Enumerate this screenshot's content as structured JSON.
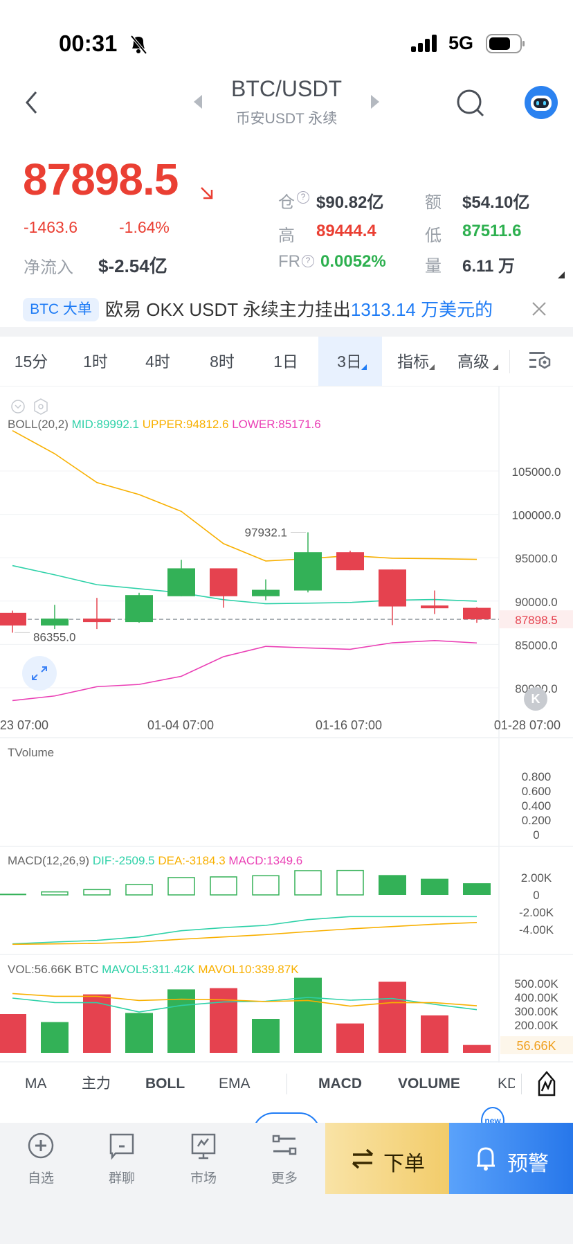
{
  "status_bar": {
    "time": "00:31",
    "network": "5G"
  },
  "header": {
    "title": "BTC/USDT",
    "subtitle": "币安USDT 永续"
  },
  "price": {
    "last": "87898.5",
    "change": "-1463.6",
    "change_pct": "-1.64%",
    "net_inflow_label": "净流入",
    "net_inflow": "$-2.54亿"
  },
  "stats": [
    {
      "label": "仓",
      "value": "$90.82亿"
    },
    {
      "label": "额",
      "value": "$54.10亿"
    },
    {
      "label": "高",
      "value": "89444.4"
    },
    {
      "label": "低",
      "value": "87511.6"
    },
    {
      "label": "FR",
      "value": "0.0052%"
    },
    {
      "label": "量",
      "value": "6.11 万"
    }
  ],
  "ticker": {
    "tag": "BTC 大单",
    "text": "欧易 OKX USDT 永续主力挂出",
    "highlight": "1313.14 万美元的"
  },
  "tabs": [
    "15分",
    "1时",
    "4时",
    "8时",
    "1日",
    "3日",
    "指标",
    "高级"
  ],
  "active_tab": "3日",
  "boll_legend": {
    "name": "BOLL(20,2)",
    "mid": "MID:89992.1",
    "upper": "UPPER:94812.6",
    "lower": "LOWER:85171.6"
  },
  "tvolume_legend": "TVolume",
  "macd_legend": {
    "name": "MACD(12,26,9)",
    "dif": "DIF:-2509.5",
    "dea": "DEA:-3184.3",
    "macd": "MACD:1349.6"
  },
  "vol_legend": {
    "name": "VOL:56.66K BTC",
    "ma5": "MAVOL5:311.42K",
    "ma10": "MAVOL10:339.87K"
  },
  "indicators": [
    "MA",
    "主力",
    "BOLL",
    "EMA",
    "MACD",
    "VOLUME",
    "KD"
  ],
  "new_badge": "new",
  "bottom_nav": [
    "自选",
    "群聊",
    "市场",
    "更多"
  ],
  "order_button": "下单",
  "alert_button": "预警",
  "colors": {
    "up": "#33b157",
    "down": "#e5424f",
    "mid": "#2ed1a8",
    "upper": "#f8b000",
    "lower": "#ea3fb5",
    "accent": "#1f7cf5"
  },
  "chart_data": {
    "type": "candlestick",
    "price_axis": [
      "105000.0",
      "100000.0",
      "95000.0",
      "90000.0",
      "85000.0",
      "80000.0"
    ],
    "x_labels": [
      "23 07:00",
      "01-04 07:00",
      "01-16 07:00",
      "01-28 07:00"
    ],
    "current_price": "87898.5",
    "max_label": "97932.1",
    "min_label": "86355.0",
    "candles": [
      [
        88640,
        88900,
        86355,
        87180
      ],
      [
        87180,
        89570,
        86780,
        87980
      ],
      [
        87980,
        90370,
        86780,
        87580
      ],
      [
        87580,
        90960,
        87500,
        90690
      ],
      [
        90560,
        94760,
        90560,
        93780
      ],
      [
        93780,
        93780,
        89230,
        90560
      ],
      [
        90560,
        92500,
        90100,
        91300
      ],
      [
        91220,
        97932.1,
        91000,
        95640
      ],
      [
        95640,
        95800,
        93560,
        93560
      ],
      [
        93640,
        93640,
        87230,
        89380
      ],
      [
        89490,
        91220,
        88510,
        89170
      ],
      [
        89220,
        89300,
        87500,
        87898.5
      ]
    ],
    "boll_upper": [
      109655,
      106995,
      103670,
      102285,
      100345,
      96620,
      94625,
      94890,
      95240,
      94945,
      94890,
      94812.6
    ],
    "boll_mid": [
      94090,
      93030,
      91890,
      91430,
      90950,
      90160,
      89700,
      89760,
      89840,
      90100,
      90180,
      89992.1
    ],
    "boll_lower": [
      78530,
      79060,
      80130,
      80390,
      81330,
      83590,
      84780,
      84600,
      84440,
      85190,
      85450,
      85171.6
    ],
    "tvolume_axis": [
      "0.800",
      "0.600",
      "0.400",
      "0.200",
      "0"
    ],
    "macd_axis": [
      "2.00K",
      "0",
      "-2.00K",
      "-4.00K"
    ],
    "macd_hist": [
      133,
      347,
      613,
      1200,
      2000,
      2080,
      2213,
      2800,
      2827,
      2293,
      1867,
      1349.6
    ],
    "dif": [
      -5653,
      -5440,
      -5253,
      -4853,
      -4133,
      -3787,
      -3520,
      -2853,
      -2507,
      -2507,
      -2507,
      -2509.5
    ],
    "dea": [
      -5707,
      -5653,
      -5600,
      -5440,
      -5120,
      -4853,
      -4587,
      -4240,
      -3920,
      -3653,
      -3387,
      -3184.3
    ],
    "vol_axis": [
      "500.00K",
      "400.00K",
      "300.00K",
      "200.00K"
    ],
    "volume_k": [
      280,
      222,
      422,
      288,
      458,
      467,
      245,
      542,
      212,
      513,
      270,
      56.66
    ],
    "current_volume": "56.66K",
    "mavol5_k": [
      395,
      363,
      362,
      295,
      342,
      367,
      372,
      400,
      380,
      392,
      350,
      311.42
    ],
    "mavol10_k": [
      428,
      408,
      408,
      378,
      387,
      383,
      370,
      378,
      337,
      363,
      362,
      339.87
    ]
  }
}
